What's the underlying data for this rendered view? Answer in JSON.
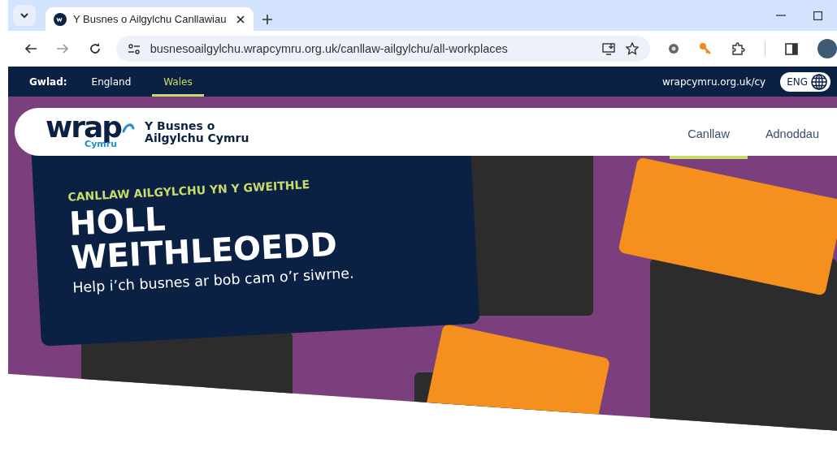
{
  "browser": {
    "tabs": [
      {
        "title": "Y Busnes o Ailgylchu Canllawiau",
        "selected": true
      }
    ],
    "address": {
      "url": "busnesoailgylchu.wrapcymru.org.uk/canllaw-ailgylchu/all-workplaces"
    }
  },
  "top_bar": {
    "country_label": "Gwlad:",
    "countries": [
      {
        "label": "England",
        "selected": false
      },
      {
        "label": "Wales",
        "selected": true
      }
    ],
    "site_link": "wrapcymru.org.uk/cy",
    "language": "ENG"
  },
  "header": {
    "logo": {
      "wordmark": "wrap",
      "subtitle": "Cymru"
    },
    "site_name": "Y Busnes o Ailgylchu Cymru",
    "nav": [
      {
        "label": "Canllaw",
        "selected": true
      },
      {
        "label": "Adnoddau",
        "selected": false
      }
    ]
  },
  "hero": {
    "eyebrow": "CANLLAW AILGYLCHU YN Y GWEITHLE",
    "title": "HOLL WEITHLEOEDD",
    "subtitle": "Help i’ch busnes ar bob cam o’r siwrne."
  }
}
